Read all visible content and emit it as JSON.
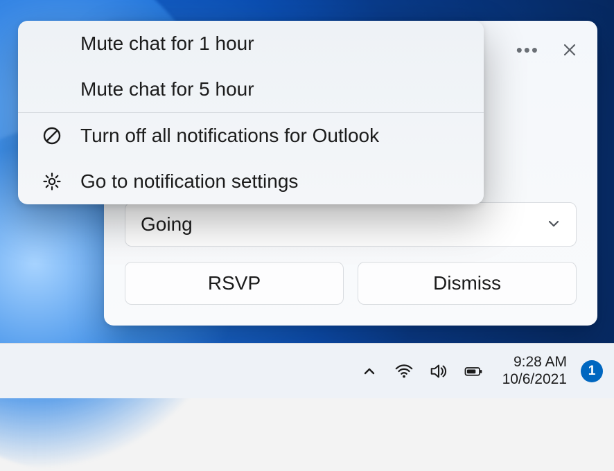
{
  "flyout": {
    "mute1": "Mute chat for 1 hour",
    "mute5": "Mute chat for 5 hour",
    "turnOff": "Turn off all notifications for Outlook",
    "settings": "Go to notification settings"
  },
  "toast": {
    "selectValue": "Going",
    "rsvp": "RSVP",
    "dismiss": "Dismiss"
  },
  "taskbar": {
    "time": "9:28 AM",
    "date": "10/6/2021",
    "badge": "1"
  }
}
